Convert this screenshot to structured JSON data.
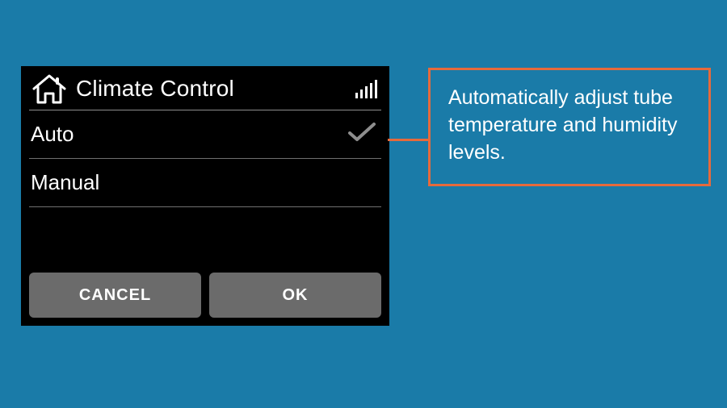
{
  "panel": {
    "title": "Climate Control",
    "options": [
      {
        "label": "Auto",
        "selected": true
      },
      {
        "label": "Manual",
        "selected": false
      }
    ],
    "buttons": {
      "cancel": "CANCEL",
      "ok": "OK"
    }
  },
  "callout": {
    "text": "Automatically adjust tube temperature and humidity levels."
  },
  "colors": {
    "background": "#1a7ba8",
    "accent": "#e66a3c",
    "panel": "#000000",
    "button": "#6b6b6b"
  }
}
